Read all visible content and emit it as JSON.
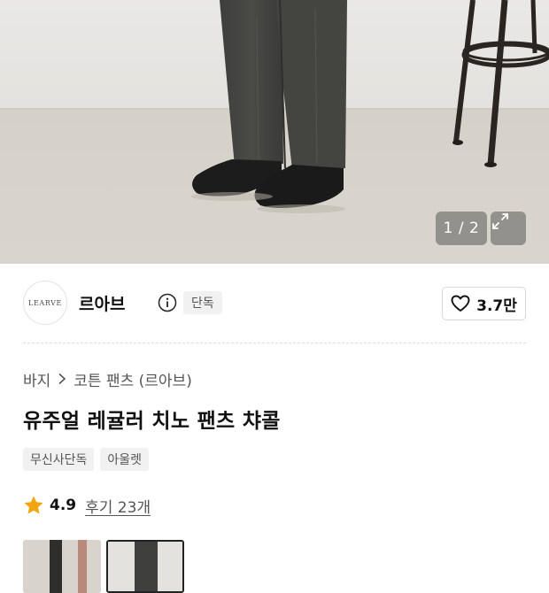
{
  "gallery": {
    "pager_current": "1",
    "pager_total": "2",
    "pager_text": "1 / 2",
    "expand_icon": "expand-icon"
  },
  "brand": {
    "logo_text": "LEARVE",
    "name": "르아브",
    "info_icon": "info-icon",
    "badge": "단독"
  },
  "like": {
    "icon": "heart-icon",
    "count": "3.7만"
  },
  "breadcrumb": {
    "category": "바지",
    "chevron_icon": "chevron-right-icon",
    "subcategory": "코튼 팬츠 (르아브)"
  },
  "product": {
    "title": "유주얼 레귤러 치노 팬츠 챠콜",
    "tags": [
      "무신사단독",
      "아울렛"
    ]
  },
  "rating": {
    "icon": "star-icon",
    "score": "4.9",
    "reviews": "후기 23개",
    "star_color": "#f2a50c"
  },
  "thumbnails": {
    "count": 2,
    "selected_index": 1
  },
  "colors": {
    "badge_bg": "#f1f1f1",
    "text_secondary": "#555555",
    "star": "#f2a50c"
  }
}
